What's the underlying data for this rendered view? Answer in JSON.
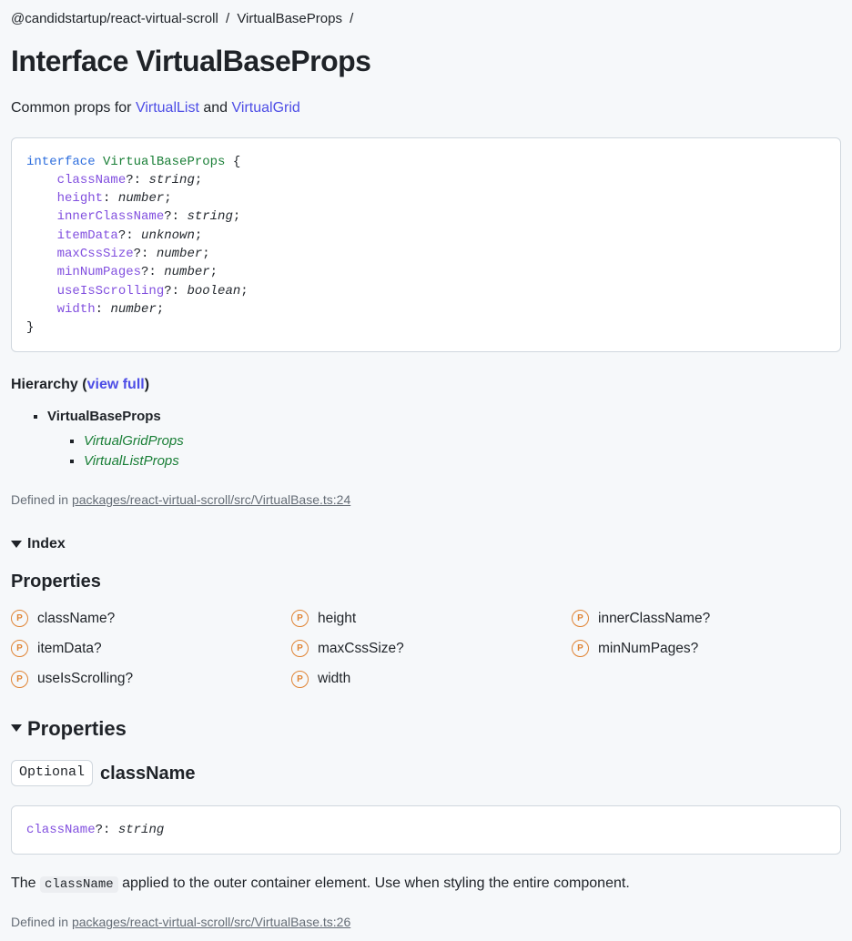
{
  "breadcrumb": {
    "pkg": "@candidstartup/react-virtual-scroll",
    "page": "VirtualBaseProps"
  },
  "title": "Interface VirtualBaseProps",
  "desc_prefix": "Common props for ",
  "desc_link1": "VirtualList",
  "desc_mid": " and ",
  "desc_link2": "VirtualGrid",
  "sig": {
    "kw": "interface",
    "name": "VirtualBaseProps",
    "props": [
      {
        "name": "className",
        "opt": true,
        "type": "string"
      },
      {
        "name": "height",
        "opt": false,
        "type": "number"
      },
      {
        "name": "innerClassName",
        "opt": true,
        "type": "string"
      },
      {
        "name": "itemData",
        "opt": true,
        "type": "unknown"
      },
      {
        "name": "maxCssSize",
        "opt": true,
        "type": "number"
      },
      {
        "name": "minNumPages",
        "opt": true,
        "type": "number"
      },
      {
        "name": "useIsScrolling",
        "opt": true,
        "type": "boolean"
      },
      {
        "name": "width",
        "opt": false,
        "type": "number"
      }
    ]
  },
  "hierarchy": {
    "label_pre": "Hierarchy (",
    "view_full": "view full",
    "label_post": ")",
    "root": "VirtualBaseProps",
    "children": [
      "VirtualGridProps",
      "VirtualListProps"
    ]
  },
  "defined_in_label": "Defined in ",
  "defined_in_1": "packages/react-virtual-scroll/src/VirtualBase.ts:24",
  "index": {
    "heading": "Index",
    "sub": "Properties",
    "items": [
      "className?",
      "height",
      "innerClassName?",
      "itemData?",
      "maxCssSize?",
      "minNumPages?",
      "useIsScrolling?",
      "width"
    ]
  },
  "properties_heading": "Properties",
  "prop_detail": {
    "badge": "Optional",
    "name": "className",
    "sig_name": "className",
    "sig_opt": "?:",
    "sig_type": "string",
    "desc_pre": "The ",
    "desc_code": "className",
    "desc_post": " applied to the outer container element. Use when styling the entire component.",
    "defined_in": "packages/react-virtual-scroll/src/VirtualBase.ts:26"
  },
  "p_letter": "P"
}
